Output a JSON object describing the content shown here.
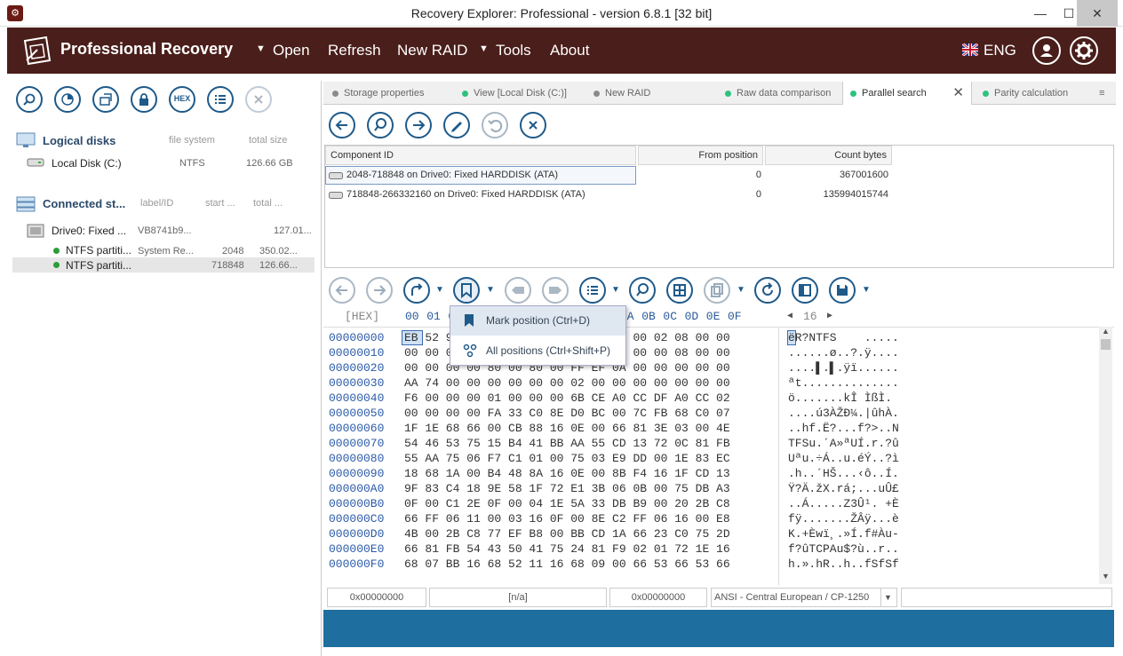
{
  "window": {
    "title": "Recovery Explorer: Professional - version 6.8.1 [32 bit]"
  },
  "menubar": {
    "brand": "Professional Recovery",
    "items": [
      {
        "label": "Open",
        "has_arrow": true
      },
      {
        "label": "Refresh",
        "has_arrow": false
      },
      {
        "label": "New RAID",
        "has_arrow": false
      },
      {
        "label": "Tools",
        "has_arrow": true
      },
      {
        "label": "About",
        "has_arrow": false
      }
    ],
    "language": "ENG"
  },
  "left_panel": {
    "toolbar_icons": [
      "zoom-icon",
      "scan-icon",
      "recover-icon",
      "lock-icon",
      "hex-icon",
      "list-icon",
      "close-icon"
    ],
    "hex_label": "HEX",
    "logical_disks": {
      "title": "Logical disks",
      "col_fs": "file system",
      "col_size": "total size",
      "items": [
        {
          "name": "Local Disk (C:)",
          "fs": "NTFS",
          "size": "126.66 GB"
        }
      ]
    },
    "connected": {
      "title": "Connected st...",
      "col_label": "label/ID",
      "col_start": "start ...",
      "col_total": "total ...",
      "drive": {
        "name": "Drive0: Fixed ...",
        "label": "VB8741b9...",
        "total": "127.01..."
      },
      "partitions": [
        {
          "name": "NTFS partiti...",
          "label": "System Re...",
          "start": "2048",
          "total": "350.02..."
        },
        {
          "name": "NTFS partiti...",
          "label": "",
          "start": "718848",
          "total": "126.66..."
        }
      ]
    }
  },
  "tabs": [
    {
      "label": "Storage properties",
      "color": "#8a8a8a",
      "active": false
    },
    {
      "label": "View [Local Disk (C:)]",
      "color": "#2ec27e",
      "active": false
    },
    {
      "label": "New RAID",
      "color": "#8a8a8a",
      "active": false
    },
    {
      "label": "Raw data comparison",
      "color": "#2ec27e",
      "active": false
    },
    {
      "label": "Parallel search",
      "color": "#2ec27e",
      "active": true
    },
    {
      "label": "Parity calculation",
      "color": "#2ec27e",
      "active": false
    }
  ],
  "grid": {
    "headers": [
      "Component ID",
      "From position",
      "Count bytes"
    ],
    "rows": [
      {
        "id": "2048-718848 on Drive0: Fixed HARDDISK (ATA)",
        "from": "0",
        "count": "367001600"
      },
      {
        "id": "718848-266332160 on Drive0: Fixed HARDDISK (ATA)",
        "from": "0",
        "count": "135994015744"
      }
    ]
  },
  "popup": {
    "items": [
      "Mark position (Ctrl+D)",
      "All positions (Ctrl+Shift+P)"
    ]
  },
  "hex": {
    "label": "[HEX]",
    "columns": [
      "00",
      "01",
      "02",
      "03",
      "04",
      "05",
      "06",
      "07",
      "08",
      "09",
      "0A",
      "0B",
      "0C",
      "0D",
      "0E",
      "0F"
    ],
    "width_label": "16",
    "rows": [
      {
        "addr": "00000000",
        "bytes": "EB 52 90 4E 54 46 53 20 20 20 20 00 02 08 00 00",
        "text": "ëR?NTFS    ....."
      },
      {
        "addr": "00000010",
        "bytes": "00 00 00 00 00 F8 00 00 3F 00 FF 00 00 08 00 00",
        "text": "......ø..?.ÿ...."
      },
      {
        "addr": "00000020",
        "bytes": "00 00 00 00 80 00 80 00 FF EF 0A 00 00 00 00 00",
        "text": "....▌.▌.ÿï......"
      },
      {
        "addr": "00000030",
        "bytes": "AA 74 00 00 00 00 00 00 02 00 00 00 00 00 00 00",
        "text": "ªt.............."
      },
      {
        "addr": "00000040",
        "bytes": "F6 00 00 00 01 00 00 00 6B CE A0 CC DF A0 CC 02",
        "text": "ö.......kÎ ÌßÌ."
      },
      {
        "addr": "00000050",
        "bytes": "00 00 00 00 FA 33 C0 8E D0 BC 00 7C FB 68 C0 07",
        "text": "....ú3ÀŽÐ¼.|ûhÀ."
      },
      {
        "addr": "00000060",
        "bytes": "1F 1E 68 66 00 CB 88 16 0E 00 66 81 3E 03 00 4E",
        "text": "..hf.Ë?...f?>..N"
      },
      {
        "addr": "00000070",
        "bytes": "54 46 53 75 15 B4 41 BB AA 55 CD 13 72 0C 81 FB",
        "text": "TFSu.´A»ªUÍ.r.?û"
      },
      {
        "addr": "00000080",
        "bytes": "55 AA 75 06 F7 C1 01 00 75 03 E9 DD 00 1E 83 EC",
        "text": "Uªu.÷Á..u.éÝ..?ì"
      },
      {
        "addr": "00000090",
        "bytes": "18 68 1A 00 B4 48 8A 16 0E 00 8B F4 16 1F CD 13",
        "text": ".h..´HŠ...‹ô..Í."
      },
      {
        "addr": "000000A0",
        "bytes": "9F 83 C4 18 9E 58 1F 72 E1 3B 06 0B 00 75 DB A3",
        "text": "Ÿ?Ä.žX.rá;...uÛ£"
      },
      {
        "addr": "000000B0",
        "bytes": "0F 00 C1 2E 0F 00 04 1E 5A 33 DB B9 00 20 2B C8",
        "text": "..Á.....Z3Û¹. +È"
      },
      {
        "addr": "000000C0",
        "bytes": "66 FF 06 11 00 03 16 0F 00 8E C2 FF 06 16 00 E8",
        "text": "fÿ.......ŽÂÿ...è"
      },
      {
        "addr": "000000D0",
        "bytes": "4B 00 2B C8 77 EF B8 00 BB CD 1A 66 23 C0 75 2D",
        "text": "K.+Èwï¸.»Í.f#Àu-"
      },
      {
        "addr": "000000E0",
        "bytes": "66 81 FB 54 43 50 41 75 24 81 F9 02 01 72 1E 16",
        "text": "f?ûTCPAu$?ù..r.."
      },
      {
        "addr": "000000F0",
        "bytes": "68 07 BB 16 68 52 11 16 68 09 00 66 53 66 53 66",
        "text": "h.».hR..h..fSfSf"
      }
    ]
  },
  "status": {
    "pos1": "0x00000000",
    "mid": "[n/a]",
    "pos2": "0x00000000",
    "encoding": "ANSI - Central European / CP-1250"
  }
}
